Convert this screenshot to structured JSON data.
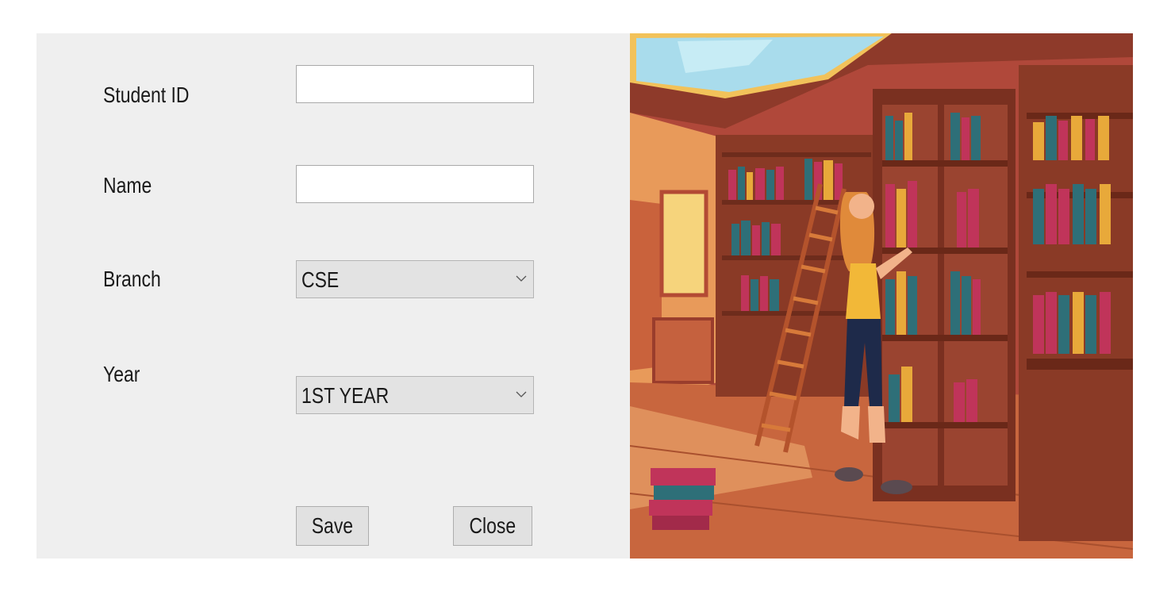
{
  "form": {
    "student_id": {
      "label": "Student ID",
      "value": ""
    },
    "name": {
      "label": "Name",
      "value": ""
    },
    "branch": {
      "label": "Branch",
      "selected": "CSE"
    },
    "year": {
      "label": "Year",
      "selected": "1ST YEAR"
    },
    "save_label": "Save",
    "close_label": "Close"
  },
  "illustration": {
    "subject": "library-illustration",
    "colors": {
      "wall": "#b8503a",
      "shelf": "#8a3a26",
      "floor": "#c8663e",
      "window": "#a9dcec",
      "book_teal": "#2e6f78",
      "book_pink": "#c0345a",
      "book_yellow": "#e8a93a"
    }
  }
}
